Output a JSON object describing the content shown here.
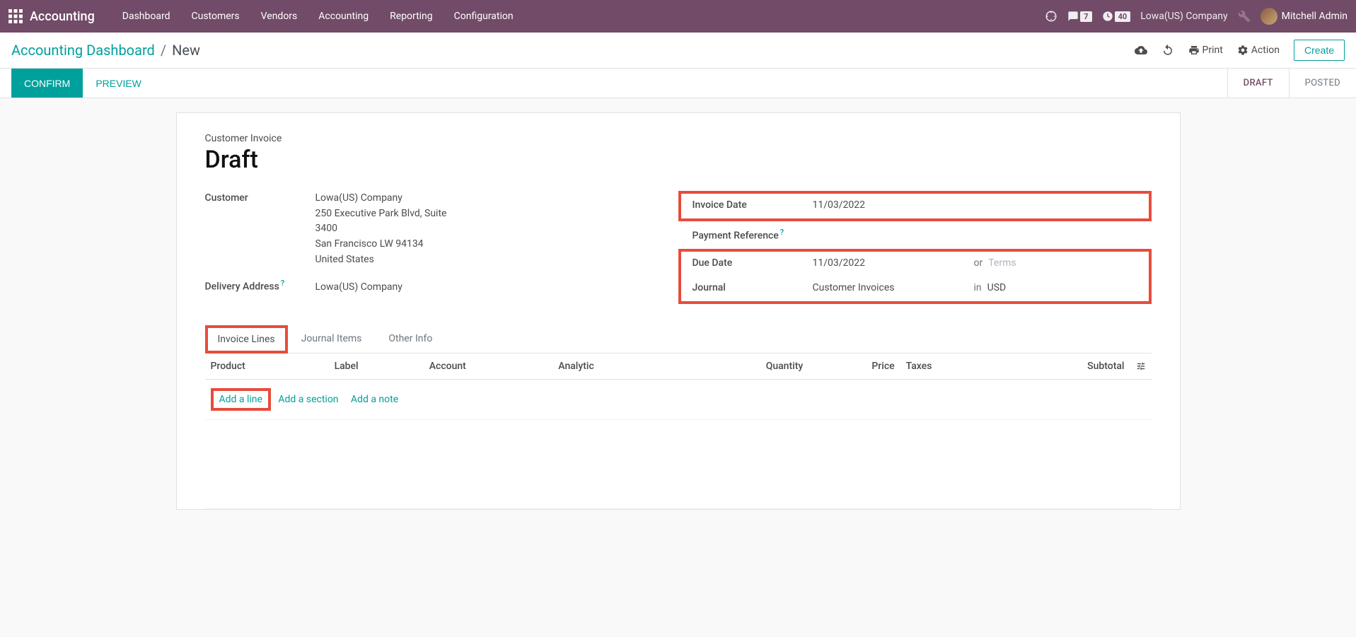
{
  "navbar": {
    "brand": "Accounting",
    "menu": [
      "Dashboard",
      "Customers",
      "Vendors",
      "Accounting",
      "Reporting",
      "Configuration"
    ],
    "messages_badge": "7",
    "activities_badge": "40",
    "company": "Lowa(US) Company",
    "user": "Mitchell Admin"
  },
  "breadcrumb": {
    "parent": "Accounting Dashboard",
    "current": "New"
  },
  "controls": {
    "print": "Print",
    "action": "Action",
    "create": "Create"
  },
  "buttons": {
    "confirm": "CONFIRM",
    "preview": "PREVIEW"
  },
  "status": {
    "draft": "DRAFT",
    "posted": "POSTED"
  },
  "form": {
    "move_type": "Customer Invoice",
    "title": "Draft",
    "labels": {
      "customer": "Customer",
      "delivery": "Delivery Address",
      "invoice_date": "Invoice Date",
      "payment_ref": "Payment Reference",
      "due_date": "Due Date",
      "journal": "Journal"
    },
    "customer": {
      "name": "Lowa(US) Company",
      "street": "250 Executive Park Blvd, Suite 3400",
      "city": "San Francisco LW 94134",
      "country": "United States"
    },
    "delivery": "Lowa(US) Company",
    "invoice_date": "11/03/2022",
    "payment_ref": "",
    "due_date": "11/03/2022",
    "due_or": "or",
    "terms_placeholder": "Terms",
    "journal": "Customer Invoices",
    "journal_in": "in",
    "currency": "USD"
  },
  "tabs": {
    "invoice_lines": "Invoice Lines",
    "journal_items": "Journal Items",
    "other_info": "Other Info"
  },
  "table": {
    "headers": {
      "product": "Product",
      "label": "Label",
      "account": "Account",
      "analytic": "Analytic",
      "quantity": "Quantity",
      "price": "Price",
      "taxes": "Taxes",
      "subtotal": "Subtotal"
    },
    "add_line": "Add a line",
    "add_section": "Add a section",
    "add_note": "Add a note"
  }
}
